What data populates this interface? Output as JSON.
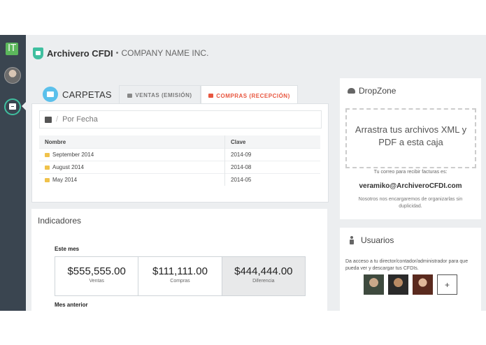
{
  "sidebar": {
    "logo": "IT"
  },
  "header": {
    "app_name": "Archivero CFDI",
    "separator": "•",
    "company": "COMPANY NAME INC."
  },
  "folders": {
    "title": "CARPETAS",
    "tabs": [
      {
        "label": "VENTAS (EMISIÓN)"
      },
      {
        "label": "COMPRAS (RECEPCIÓN)",
        "active": true
      }
    ],
    "breadcrumb": {
      "sep": "/",
      "label": "Por Fecha"
    },
    "table": {
      "headers": [
        "Nombre",
        "Clave"
      ],
      "rows": [
        [
          "September 2014",
          "2014-09"
        ],
        [
          "August 2014",
          "2014-08"
        ],
        [
          "May 2014",
          "2014-05"
        ]
      ]
    }
  },
  "indicators": {
    "title": "Indicadores",
    "current_label": "Este mes",
    "metrics": [
      {
        "value": "$555,555.00",
        "label": "Ventas"
      },
      {
        "value": "$111,111.00",
        "label": "Compras"
      },
      {
        "value": "$444,444.00",
        "label": "Diferencia"
      }
    ],
    "previous_label": "Mes anterior"
  },
  "dropzone": {
    "title": "DropZone",
    "drop_text": "Arrastra tus archivos XML y PDF a esta caja",
    "email_note": "Tu correo para recibir facturas es:",
    "email": "veramiko@ArchiveroCFDI.com",
    "note": "Nosotros nos encargaremos de organizarlas sin duplicidad."
  },
  "users": {
    "title": "Usuarios",
    "description": "Da acceso a tu director/contador/administrador para que pueda ver y descargar tus CFDIs.",
    "add_label": "+"
  },
  "colors": {
    "accent": "#3fbf9f",
    "active_tab": "#e8563f",
    "sidebar": "#3a4550",
    "folder": "#f0c24b",
    "info": "#5bc0eb"
  }
}
